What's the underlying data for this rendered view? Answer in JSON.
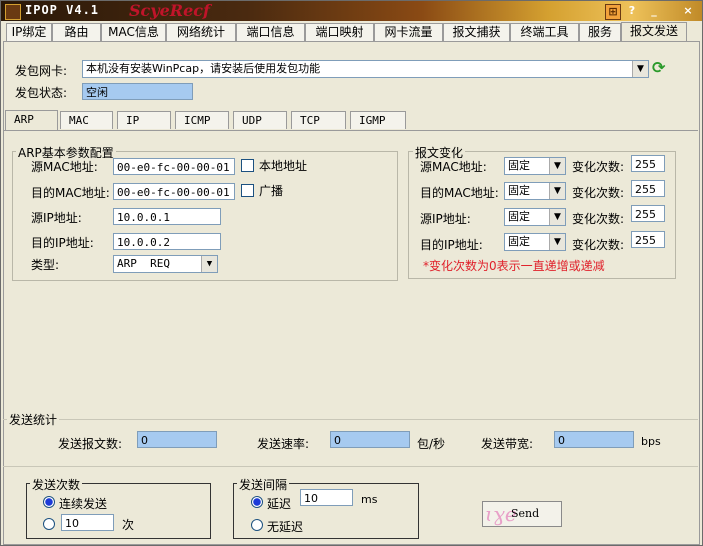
{
  "window": {
    "title": "IPOP V4.1",
    "title_decoration": "ScyeRecf"
  },
  "title_buttons": {
    "menu": "⊞",
    "help": "?",
    "minimize": "_",
    "close": "×"
  },
  "main_tabs": [
    "IP绑定",
    "路由",
    "MAC信息",
    "网络统计",
    "端口信息",
    "端口映射",
    "网卡流量",
    "报文捕获",
    "终端工具",
    "服务",
    "报文发送"
  ],
  "adapter": {
    "label": "发包网卡:",
    "value": "本机没有安装WinPcap，请安装后使用发包功能",
    "status_label": "发包状态:",
    "status_value": "空闲"
  },
  "sub_tabs": [
    "ARP",
    "MAC",
    "IP",
    "ICMP",
    "UDP",
    "TCP",
    "IGMP"
  ],
  "arp": {
    "group_title": "ARP基本参数配置",
    "src_mac_label": "源MAC地址:",
    "src_mac_value": "00-e0-fc-00-00-01",
    "local_addr_label": "本地地址",
    "dst_mac_label": "目的MAC地址:",
    "dst_mac_value": "00-e0-fc-00-00-01",
    "broadcast_label": "广播",
    "src_ip_label": "源IP地址:",
    "src_ip_value": "10.0.0.1",
    "dst_ip_label": "目的IP地址:",
    "dst_ip_value": "10.0.0.2",
    "type_label": "类型:",
    "type_value": "ARP  REQ"
  },
  "change": {
    "group_title": "报文变化",
    "rows": [
      {
        "label": "源MAC地址:",
        "mode": "固定",
        "count_label": "变化次数:",
        "count": "255"
      },
      {
        "label": "目的MAC地址:",
        "mode": "固定",
        "count_label": "变化次数:",
        "count": "255"
      },
      {
        "label": "源IP地址:",
        "mode": "固定",
        "count_label": "变化次数:",
        "count": "255"
      },
      {
        "label": "目的IP地址:",
        "mode": "固定",
        "count_label": "变化次数:",
        "count": "255"
      }
    ],
    "note": "*变化次数为0表示一直递增或递减"
  },
  "stats": {
    "group_title": "发送统计",
    "packets_label": "发送报文数:",
    "packets_value": "0",
    "rate_label": "发送速率:",
    "rate_value": "0",
    "rate_unit": "包/秒",
    "bandwidth_label": "发送带宽:",
    "bandwidth_value": "0",
    "bandwidth_unit": "bps"
  },
  "send_count": {
    "group_title": "发送次数",
    "continuous_label": "连续发送",
    "count_value": "10",
    "count_unit": "次"
  },
  "send_interval": {
    "group_title": "发送间隔",
    "delay_label": "延迟",
    "delay_value": "10",
    "delay_unit": "ms",
    "no_delay_label": "无延迟"
  },
  "send_button": {
    "label": "Send"
  },
  "colors": {
    "status_field": "#a6caf0",
    "note": "#e0202a",
    "radio_dot": "#1c3ad8"
  }
}
